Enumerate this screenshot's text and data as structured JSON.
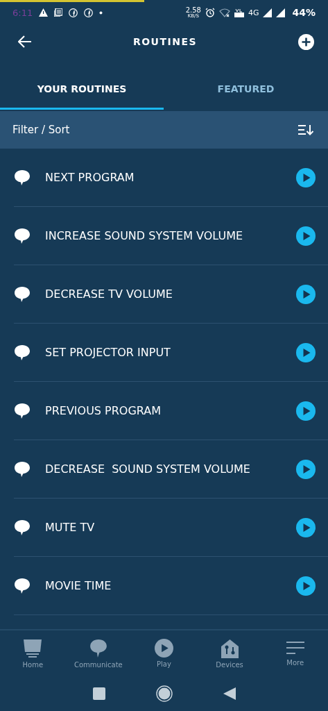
{
  "status_bar": {
    "time": "6:11",
    "speed": "2.58",
    "speed_unit": "KB/S",
    "network": "4G",
    "battery": "44%"
  },
  "header": {
    "title": "ROUTINES"
  },
  "tabs": [
    {
      "label": "YOUR ROUTINES",
      "selected": true
    },
    {
      "label": "FEATURED",
      "selected": false
    }
  ],
  "filter": {
    "label": "Filter / Sort"
  },
  "routines": [
    {
      "name": "NEXT PROGRAM"
    },
    {
      "name": "INCREASE SOUND SYSTEM VOLUME"
    },
    {
      "name": "DECREASE TV VOLUME"
    },
    {
      "name": "SET PROJECTOR INPUT"
    },
    {
      "name": "PREVIOUS PROGRAM"
    },
    {
      "name": "DECREASE  SOUND SYSTEM VOLUME"
    },
    {
      "name": "MUTE TV"
    },
    {
      "name": "MOVIE TIME"
    }
  ],
  "bottom_nav": [
    {
      "label": "Home",
      "kind": "home"
    },
    {
      "label": "Communicate",
      "kind": "communicate"
    },
    {
      "label": "Play",
      "kind": "play"
    },
    {
      "label": "Devices",
      "kind": "devices"
    },
    {
      "label": "More",
      "kind": "more"
    }
  ]
}
